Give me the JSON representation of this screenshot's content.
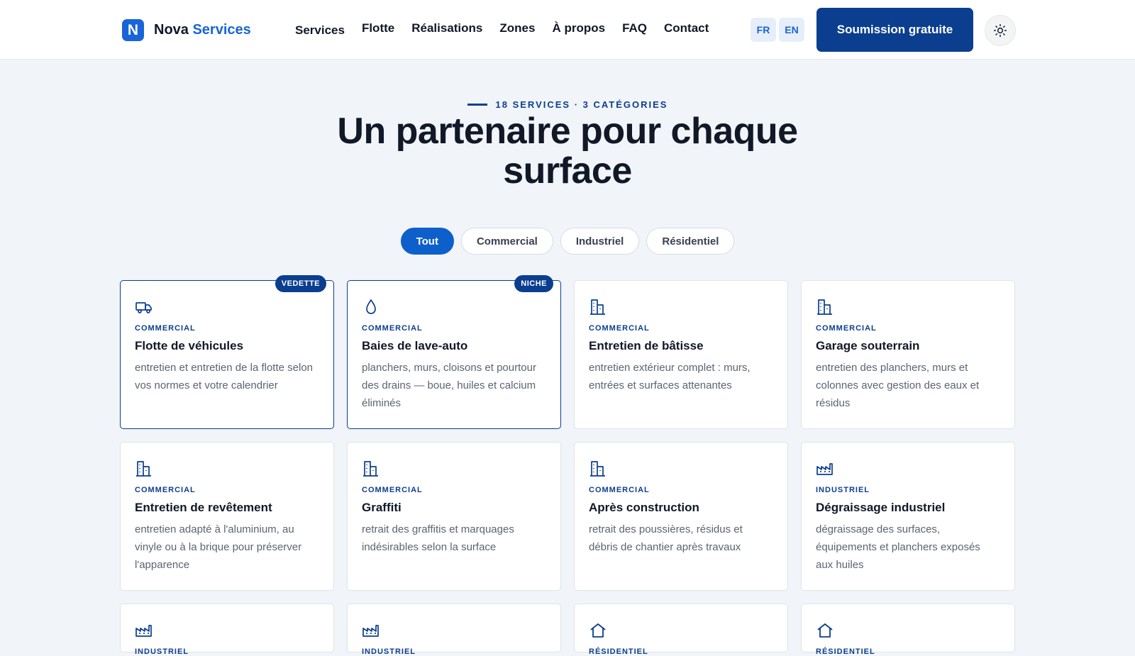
{
  "brand": {
    "mark": "N",
    "name": "Nova",
    "accent": "Services"
  },
  "nav": [
    "Services",
    "Flotte",
    "Réalisations",
    "Zones",
    "À propos",
    "FAQ",
    "Contact"
  ],
  "languages": [
    "FR",
    "EN"
  ],
  "cta_label": "Soumission gratuite",
  "theme_toggle_icon": "sun-icon",
  "hero": {
    "eyebrow": "18 SERVICES · 3 CATÉGORIES",
    "title": "Un partenaire pour chaque surface"
  },
  "filters": [
    {
      "label": "Tout",
      "active": true
    },
    {
      "label": "Commercial",
      "active": false
    },
    {
      "label": "Industriel",
      "active": false
    },
    {
      "label": "Résidentiel",
      "active": false
    }
  ],
  "services": [
    {
      "icon": "truck-icon",
      "badge": "VEDETTE",
      "category": "COMMERCIAL",
      "title": "Flotte de véhicules",
      "description": "entretien et entretien de la flotte selon vos normes et votre calendrier"
    },
    {
      "icon": "droplet-icon",
      "badge": "NICHE",
      "category": "COMMERCIAL",
      "title": "Baies de lave-auto",
      "description": "planchers, murs, cloisons et pourtour des drains — boue, huiles et calcium éliminés"
    },
    {
      "icon": "building-icon",
      "badge": "",
      "category": "COMMERCIAL",
      "title": "Entretien de bâtisse",
      "description": "entretien extérieur complet : murs, entrées et surfaces attenantes"
    },
    {
      "icon": "building-icon",
      "badge": "",
      "category": "COMMERCIAL",
      "title": "Garage souterrain",
      "description": "entretien des planchers, murs et colonnes avec gestion des eaux et résidus"
    },
    {
      "icon": "building-icon",
      "badge": "",
      "category": "COMMERCIAL",
      "title": "Entretien de revêtement",
      "description": "entretien adapté à l'aluminium, au vinyle ou à la brique pour préserver l'apparence"
    },
    {
      "icon": "building-icon",
      "badge": "",
      "category": "COMMERCIAL",
      "title": "Graffiti",
      "description": "retrait des graffitis et marquages indésirables selon la surface"
    },
    {
      "icon": "building-icon",
      "badge": "",
      "category": "COMMERCIAL",
      "title": "Après construction",
      "description": "retrait des poussières, résidus et débris de chantier après travaux"
    },
    {
      "icon": "factory-icon",
      "badge": "",
      "category": "INDUSTRIEL",
      "title": "Dégraissage industriel",
      "description": "dégraissage des surfaces, équipements et planchers exposés aux huiles"
    },
    {
      "icon": "factory-icon",
      "badge": "",
      "category": "INDUSTRIEL",
      "title": "",
      "description": ""
    },
    {
      "icon": "factory-icon",
      "badge": "",
      "category": "INDUSTRIEL",
      "title": "",
      "description": ""
    },
    {
      "icon": "house-icon",
      "badge": "",
      "category": "RÉSIDENTIEL",
      "title": "",
      "description": ""
    },
    {
      "icon": "house-icon",
      "badge": "",
      "category": "RÉSIDENTIEL",
      "title": "",
      "description": ""
    }
  ],
  "colors": {
    "primary": "#0b3e8f",
    "accent": "#1765d8",
    "background": "#f1f4f8"
  }
}
